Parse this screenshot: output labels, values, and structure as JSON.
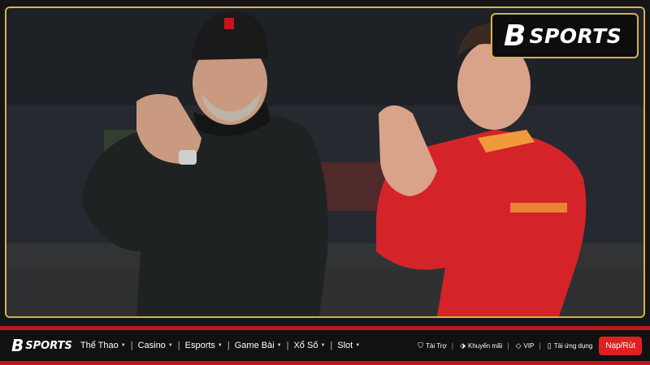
{
  "brand": {
    "logo_mark": "B",
    "logo_text": "SPORTS"
  },
  "photo": {
    "subject": "",
    "colors": {
      "jacket": "#1f2222",
      "kit_red": "#d4242a",
      "gold_frame": "#d8b24a"
    }
  },
  "nav": {
    "items": [
      {
        "label": "Thể Thao"
      },
      {
        "label": "Casino"
      },
      {
        "label": "Esports"
      },
      {
        "label": "Game Bài"
      },
      {
        "label": "Xổ Số"
      },
      {
        "label": "Slot"
      }
    ],
    "right_links": [
      {
        "label": "Tài Trợ",
        "icon": "shield-icon"
      },
      {
        "label": "Khuyến mãi",
        "icon": "tag-icon"
      },
      {
        "label": "VIP",
        "icon": "diamond-icon"
      },
      {
        "label": "Tải ứng dụng",
        "icon": "phone-icon"
      }
    ],
    "cta": "Nạp/Rút"
  }
}
